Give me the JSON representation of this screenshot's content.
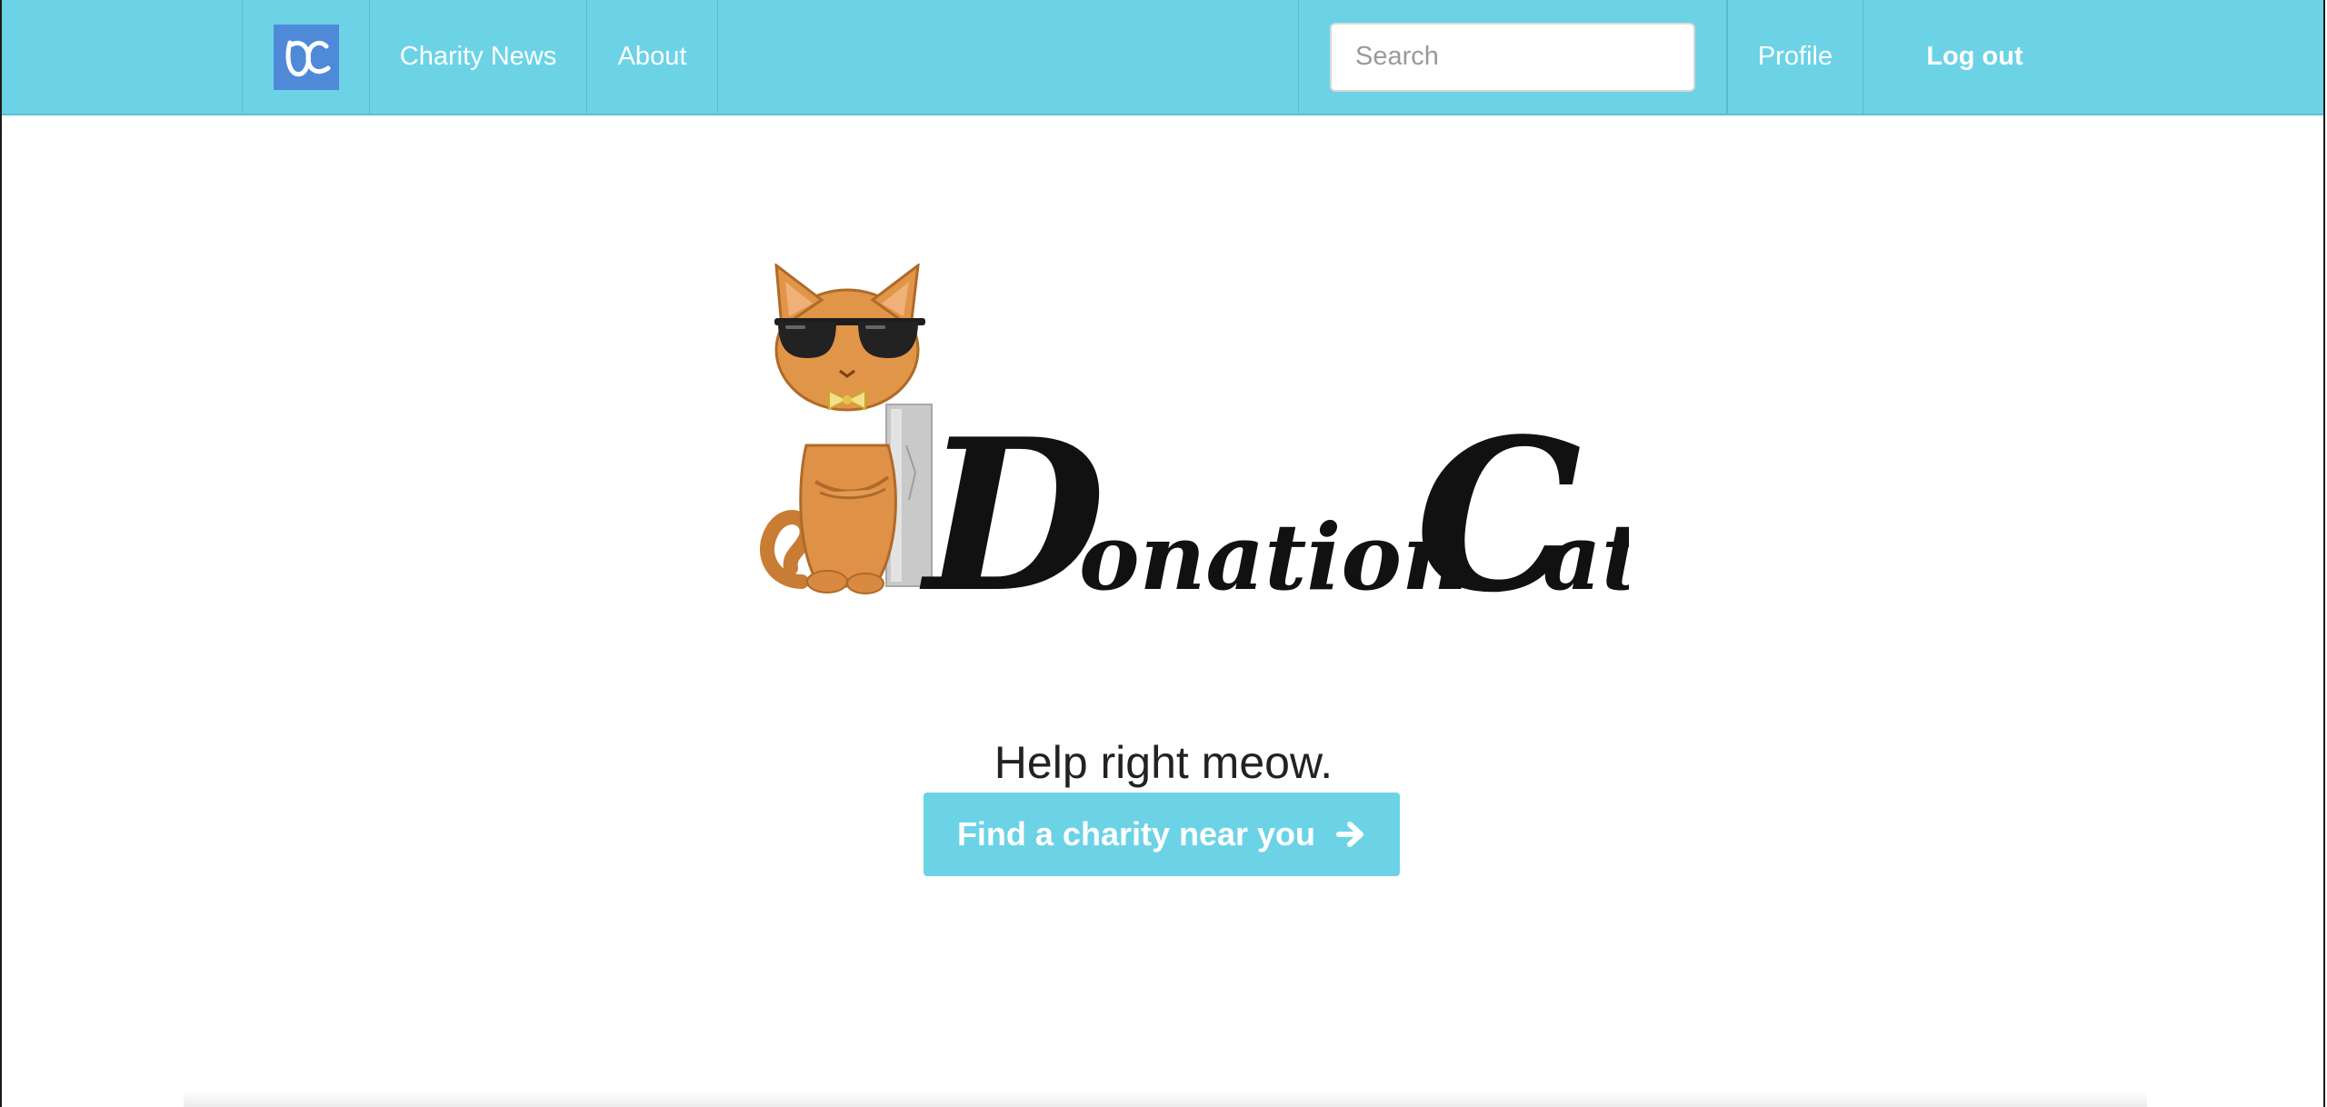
{
  "navbar": {
    "brand_logo_text": "DC",
    "links": {
      "charity_news": "Charity News",
      "about": "About",
      "profile": "Profile",
      "logout": "Log out"
    },
    "search": {
      "placeholder": "Search",
      "value": ""
    }
  },
  "hero": {
    "logo_wordmark_first": "D",
    "logo_wordmark_mid": "onation",
    "logo_wordmark_second": "C",
    "logo_wordmark_end": "at",
    "tagline": "Help right meow.",
    "cta_label": "Find a charity near you"
  },
  "colors": {
    "navbar": "#6cd3e6",
    "brand_logo": "#4f8ad9",
    "cta": "#6cd3e6",
    "text": "#222222"
  },
  "icons": {
    "cta_icon": "arrow-right-icon",
    "hero_mascot": "cat-with-sunglasses-icon"
  }
}
